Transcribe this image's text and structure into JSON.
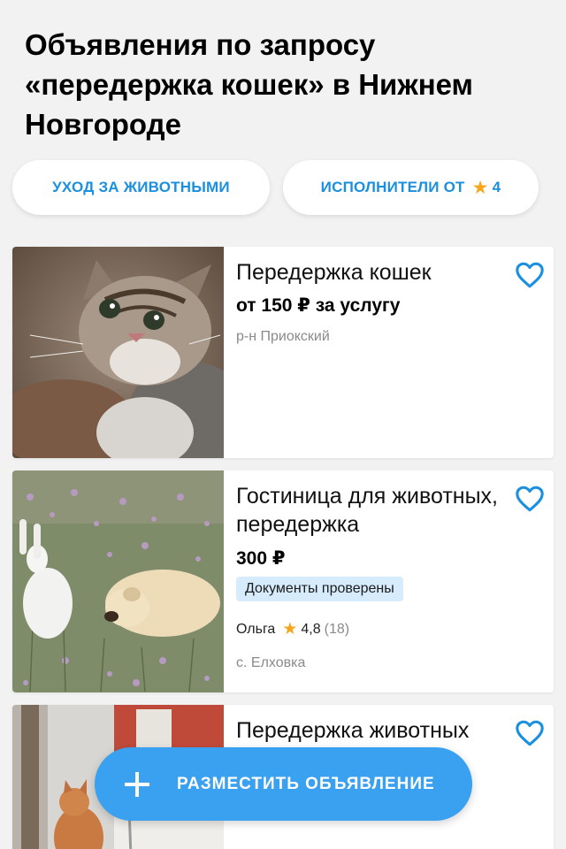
{
  "header": {
    "title": "Объявления по запросу «передержка кошек» в Нижнем Новгороде"
  },
  "filters": [
    {
      "label": "УХОД ЗА ЖИВОТНЫМИ"
    },
    {
      "label": "ИСПОЛНИТЕЛИ ОТ",
      "rating": "4",
      "icon": "star-icon"
    }
  ],
  "listings": [
    {
      "title": "Передержка кошек",
      "price": "от 150 ₽ за услугу",
      "location": "р-н Приокский",
      "image": "kitten-photo"
    },
    {
      "title": "Гостиница для животных, передержка",
      "price": "300 ₽",
      "badge": "Документы проверены",
      "seller": "Ольга",
      "rating": "4,8",
      "reviews": "(18)",
      "location": "с. Елховка",
      "image": "rabbit-and-puppy-photo"
    },
    {
      "title": "Передержка животных",
      "image": "cat-in-room-photo"
    }
  ],
  "fab": {
    "label": "РАЗМЕСТИТЬ ОБЪЯВЛЕНИЕ",
    "icon": "plus-icon"
  },
  "colors": {
    "accent": "#1b8fe0",
    "fab": "#3aa0f0",
    "star": "#f7a51c",
    "badge_bg": "#d6ebfb"
  }
}
